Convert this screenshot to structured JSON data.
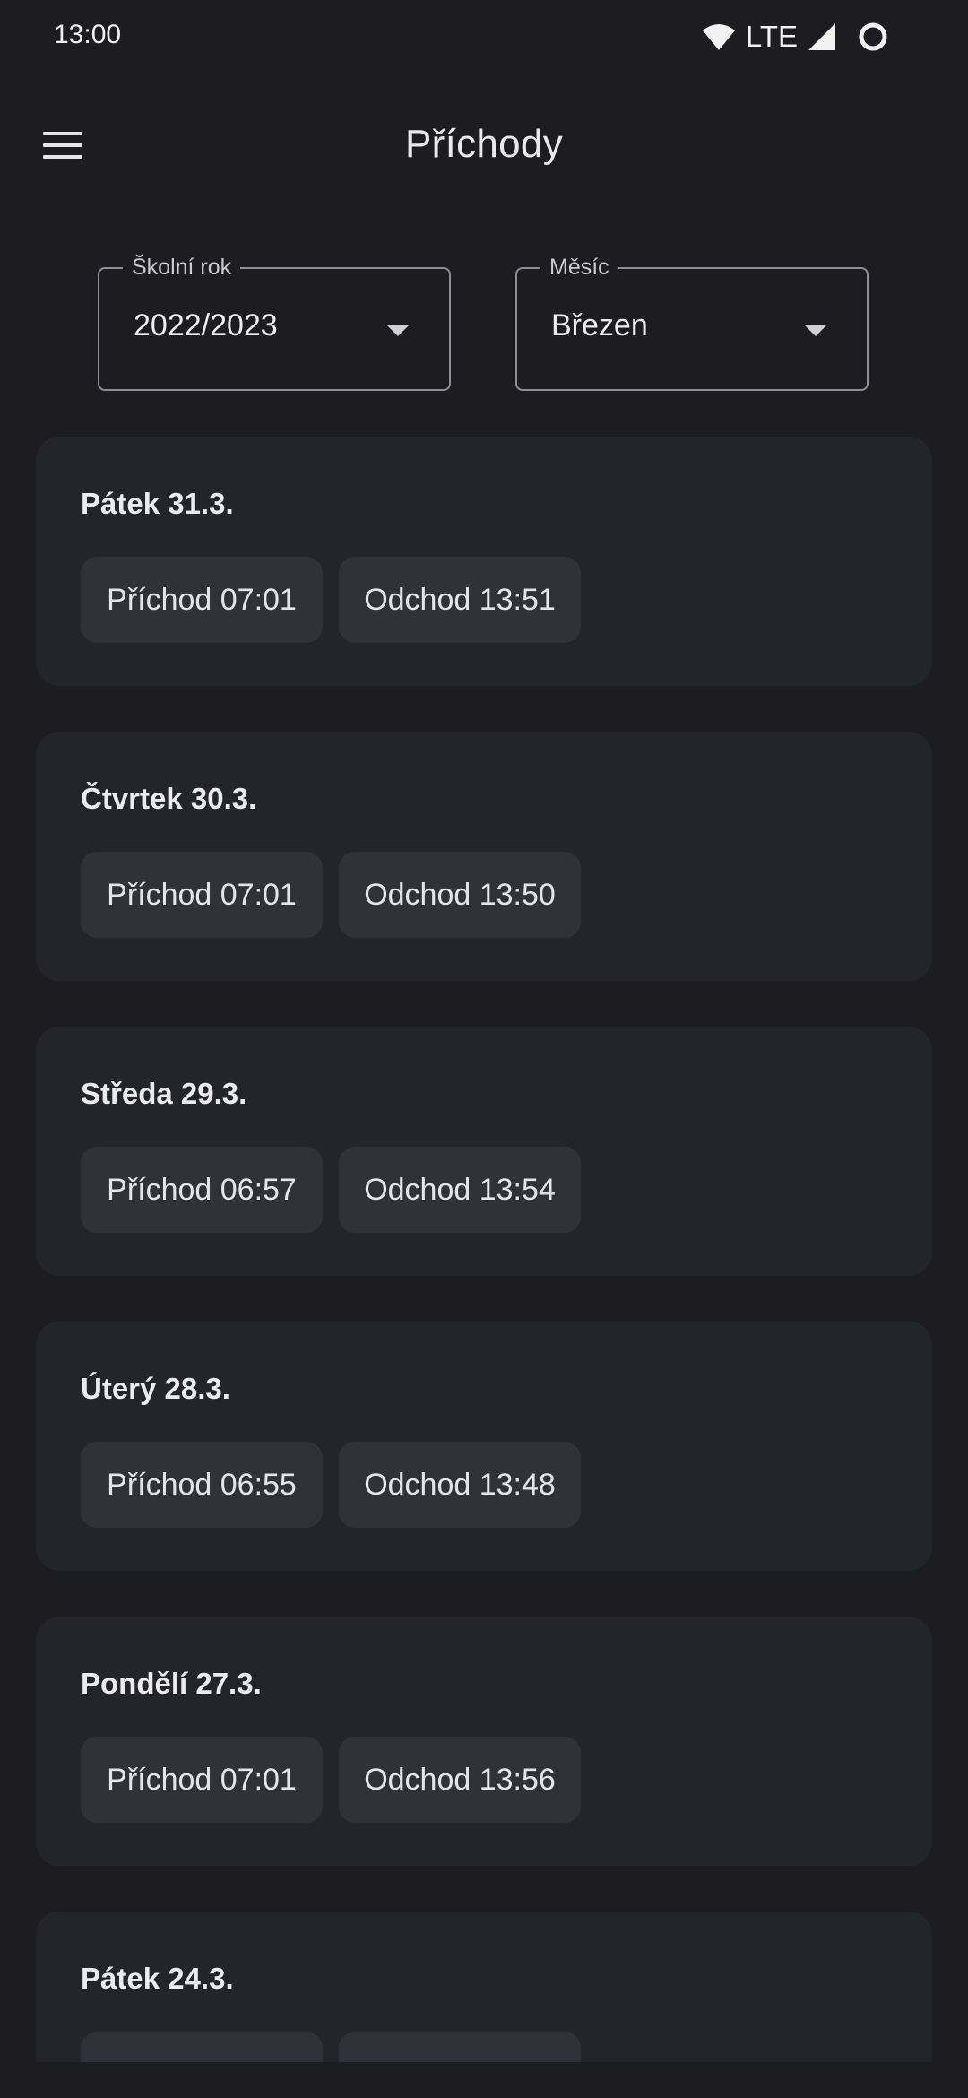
{
  "status_bar": {
    "time": "13:00",
    "network": "LTE",
    "icons": [
      "wifi-icon",
      "signal-icon",
      "battery-circle-icon"
    ]
  },
  "header": {
    "menu_icon": "hamburger-menu-icon",
    "title": "Příchody"
  },
  "filters": {
    "school_year": {
      "label": "Školní rok",
      "value": "2022/2023"
    },
    "month": {
      "label": "Měsíc",
      "value": "Březen"
    }
  },
  "days": [
    {
      "date": "Pátek 31.3.",
      "arrival": "Příchod 07:01",
      "departure": "Odchod 13:51"
    },
    {
      "date": "Čtvrtek 30.3.",
      "arrival": "Příchod 07:01",
      "departure": "Odchod 13:50"
    },
    {
      "date": "Středa 29.3.",
      "arrival": "Příchod 06:57",
      "departure": "Odchod 13:54"
    },
    {
      "date": "Úterý 28.3.",
      "arrival": "Příchod 06:55",
      "departure": "Odchod 13:48"
    },
    {
      "date": "Pondělí 27.3.",
      "arrival": "Příchod 07:01",
      "departure": "Odchod 13:56"
    },
    {
      "date": "Pátek 24.3.",
      "arrival": "",
      "departure": ""
    }
  ],
  "colors": {
    "background": "#1c1c21",
    "card": "#24242b",
    "chip": "#31313a",
    "outline": "#8e8e96"
  }
}
